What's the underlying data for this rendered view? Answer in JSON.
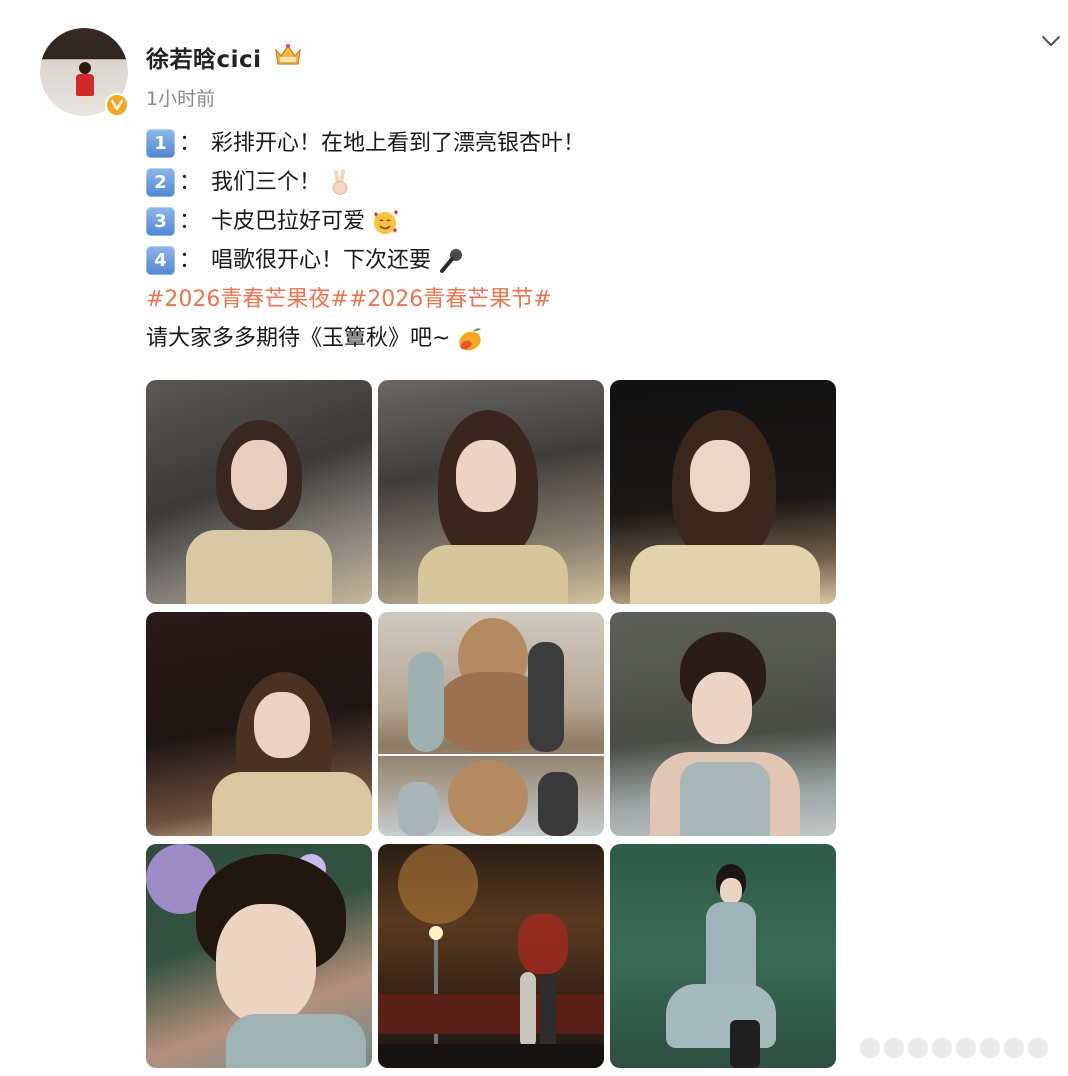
{
  "post": {
    "username": "徐若晗cici",
    "timestamp": "1小时前",
    "lines": [
      {
        "num": "1",
        "text": "彩排开心！在地上看到了漂亮银杏叶！"
      },
      {
        "num": "2",
        "text": "我们三个！"
      },
      {
        "num": "3",
        "text": "卡皮巴拉好可爱"
      },
      {
        "num": "4",
        "text": "唱歌很开心！下次还要"
      }
    ],
    "colon": "：",
    "hashtags": "#2026青春芒果夜##2026青春芒果节#",
    "closing": "请大家多多期待《玉簟秋》吧~"
  },
  "icons": {
    "verified": "verified-badge-icon",
    "vip": "vip-crown-icon",
    "more": "chevron-down-icon",
    "emojis": [
      "victory-hand-emoji",
      "smiling-face-with-hearts-emoji",
      "microphone-emoji",
      "mango-emoji"
    ]
  },
  "colors": {
    "hashtag": "#eb7350",
    "verified": "#f5a623",
    "keycap": "#4f86d2"
  },
  "images": [
    "photo-1",
    "photo-2",
    "photo-3",
    "photo-4",
    "photo-5",
    "photo-6",
    "photo-7",
    "photo-8",
    "photo-9"
  ]
}
